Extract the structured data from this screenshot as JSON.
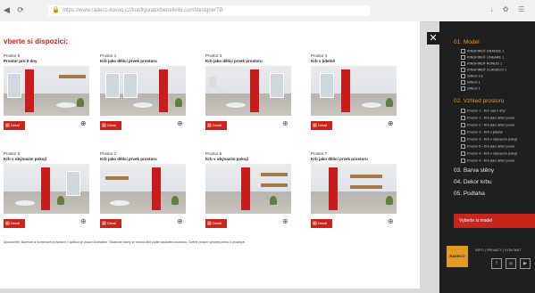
{
  "browser": {
    "url": "https://www.radeco.kovoo.cz/konfiguratorbenelli/ibi.com/designerTB",
    "nav_icons": "◀ ⟳",
    "right_icons": "↓ ✿ ☰"
  },
  "page": {
    "title": "vberte si dispozici:",
    "cards": [
      {
        "variant": "Prostor 9",
        "title": "Prostor pro 2 dny",
        "button": "Detail"
      },
      {
        "variant": "Prostor 1",
        "title": "Krb jako dělicí prvek prostoru",
        "button": "Detail"
      },
      {
        "variant": "Prostor 3",
        "title": "Krb jako dělicí prvek prostoru",
        "button": "Detail"
      },
      {
        "variant": "Prostor 4",
        "title": "Krb v jídelně",
        "button": "Detail"
      },
      {
        "variant": "Prostor 5",
        "title": "Krb v obývacím pokoji",
        "button": "Detail"
      },
      {
        "variant": "Prostor 2",
        "title": "Krb jako dělicí prvek prostoru",
        "button": "Detail"
      },
      {
        "variant": "Prostor 6",
        "title": "Krb v obývacím pokoji",
        "button": "Detail"
      },
      {
        "variant": "Prostor 7",
        "title": "Krb jako dělicí prvek prostoru",
        "button": "Detail"
      }
    ],
    "footer_note": "Upozornění: Barevné a rozměrové provedení v aplikaci je pouze ilustrativní. Skutečné barvy se mohou lišit podle nastavení monitoru. Ověřte prosím výrobek přímo u prodejce."
  },
  "panel": {
    "close": "✕",
    "sec1": "01. Model",
    "models": [
      "KINGFIRE® GRANDE 1",
      "KINGFIRE® LINEARE 1",
      "KINGFIRE® RONDO 1",
      "KINGFIRE® CLASSICO 1",
      "SINUS 1G",
      "SINUS 1",
      "SINUS 1"
    ],
    "sec2": "02. Vzhled prostoru",
    "spaces": [
      "Prostor 1 - Krb nad 2 dny",
      "Prostor 1 - Krb jako dělicí prvek",
      "Prostor 2 - Krb jako dělicí prvek",
      "Prostor 3 - Krb v jídelně",
      "Prostor 3 - Krb v obývacím pokoji",
      "Prostor 5 - Krb jako dělicí prvek",
      "Prostor 4 - Krb v obývacím pokoji",
      "Prostor 4 - Krb jako dělicí prvek"
    ],
    "sec3": "03. Barva stěny",
    "sec4": "04. Dekor krbu",
    "sec5": "05. Podlaha",
    "cta": "Vyberte si model",
    "logo": "RADECO",
    "links": "INFO | PRIVACY | KONTAKT",
    "social": [
      "f",
      "◎",
      "▶"
    ]
  },
  "colors": {
    "accent": "#c8261c",
    "panel_bg": "#1f1f1f",
    "section_accent": "#e39a22"
  }
}
